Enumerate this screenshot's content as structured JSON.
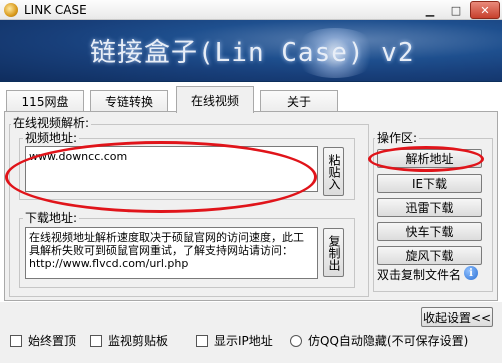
{
  "window": {
    "title": "LINK CASE"
  },
  "banner": {
    "title": "链接盒子(Lin Case) v2"
  },
  "tabs": [
    {
      "label": "115网盘",
      "active": false
    },
    {
      "label": "专链转换",
      "active": false
    },
    {
      "label": "在线视频",
      "active": true
    },
    {
      "label": "关于",
      "active": false
    }
  ],
  "parse_group": {
    "legend": "在线视频解析:",
    "video_address": {
      "legend": "视频地址:",
      "value": "www.downcc.com",
      "paste_button": "粘贴入"
    },
    "download_address": {
      "legend": "下载地址:",
      "text": "在线视频地址解析速度取决于硕鼠官网的访问速度，此工具解析失败可到硕鼠官网重试，了解支持网站请访问：http://www.flvcd.com/url.php",
      "copy_button": "复制出"
    }
  },
  "operations": {
    "legend": "操作区:",
    "buttons": [
      "解析地址",
      "IE下载",
      "迅雷下载",
      "快车下载",
      "旋风下载"
    ],
    "double_click_label": "双击复制文件名"
  },
  "footer": {
    "close_settings": "收起设置<<",
    "options": [
      {
        "label": "始终置顶",
        "type": "checkbox"
      },
      {
        "label": "监视剪贴板",
        "type": "checkbox"
      },
      {
        "label": "显示IP地址",
        "type": "checkbox"
      },
      {
        "label": "仿QQ自动隐藏(不可保存设置)",
        "type": "radio"
      }
    ]
  },
  "colors": {
    "annotation": "#e0141a",
    "banner": "#1e4f8e"
  }
}
